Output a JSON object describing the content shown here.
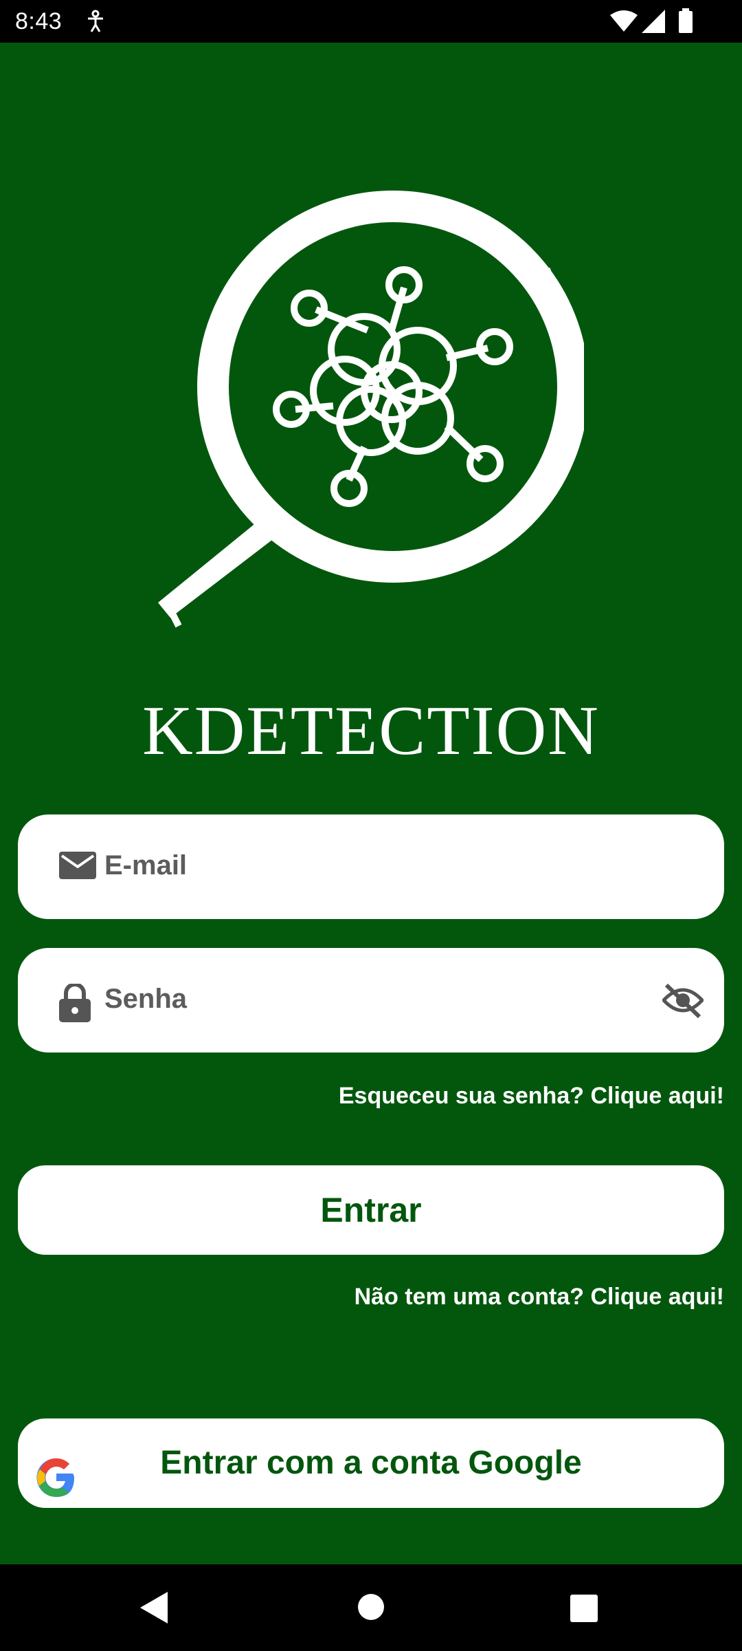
{
  "status_bar": {
    "time": "8:43",
    "app_icon": "accessibility-icon",
    "wifi_icon": "wifi-icon",
    "signal_icon": "signal-icon",
    "battery_icon": "battery-icon"
  },
  "brand": {
    "logo_icon": "magnifier-molecule-logo",
    "name": "KDETECTION"
  },
  "form": {
    "email_placeholder": "E-mail",
    "email_icon": "mail-icon",
    "password_placeholder": "Senha",
    "password_icon": "lock-icon",
    "visibility_icon": "eye-off-icon",
    "forgot_link": "Esqueceu sua senha? Clique aqui!",
    "login_button": "Entrar",
    "signup_link": "Não tem uma conta? Clique aqui!",
    "google_button": "Entrar com a conta Google",
    "google_icon": "google-g-icon"
  },
  "nav": {
    "back_icon": "back-triangle-icon",
    "home_icon": "home-circle-icon",
    "recent_icon": "recent-square-icon"
  },
  "colors": {
    "background": "#03570D",
    "accent_text": "#03570D",
    "field_bg": "#FFFFFF",
    "placeholder": "#5C5C5C"
  }
}
